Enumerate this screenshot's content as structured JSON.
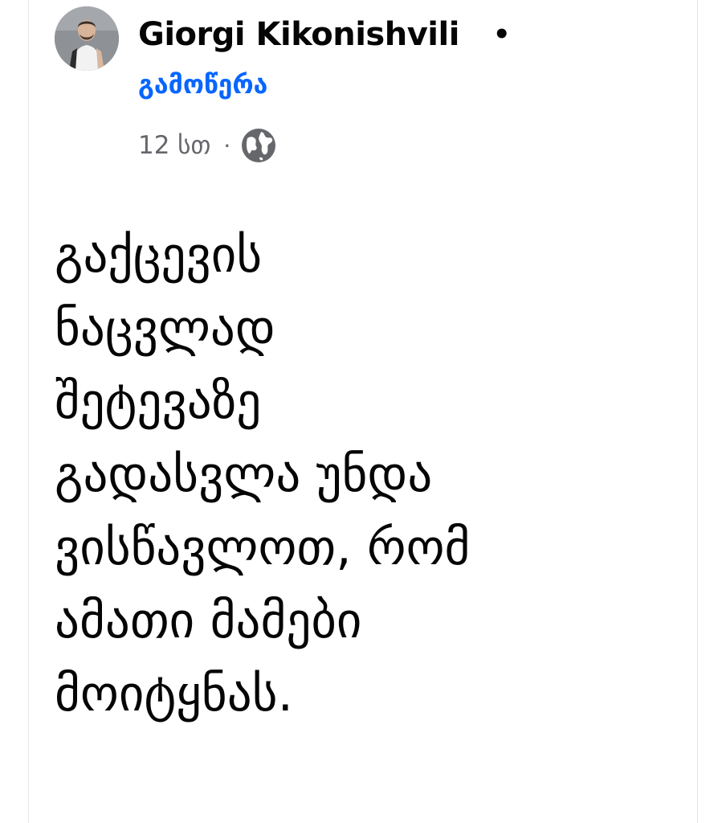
{
  "post": {
    "author": {
      "name": "Giorgi Kikonishvili",
      "separator": "•"
    },
    "follow_label": "გამოწერა",
    "meta": {
      "time": "12 სთ",
      "separator": "·",
      "audience_icon": "globe-icon"
    },
    "text_lines": [
      "გაქცევის",
      "ნაცვლად",
      "შეტევაზე",
      "გადასვლა უნდა",
      "ვისწავლოთ, რომ",
      "ამათი მამები",
      "მოიტყნას."
    ]
  },
  "colors": {
    "link_blue": "#0866ff",
    "meta_gray": "#65676b",
    "text": "#050505",
    "background": "#ffffff"
  }
}
